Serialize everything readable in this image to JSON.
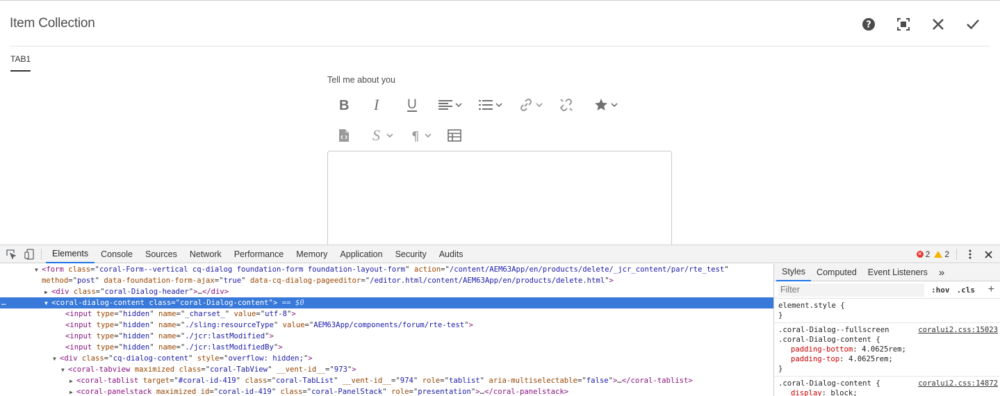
{
  "dialog": {
    "title": "Item Collection",
    "tab_label": "TAB1",
    "field_label": "Tell me about you",
    "actions": [
      "help-icon",
      "fullscreen-icon",
      "close-icon",
      "done-icon"
    ]
  },
  "devtools": {
    "tabs": [
      "Elements",
      "Console",
      "Sources",
      "Network",
      "Performance",
      "Memory",
      "Application",
      "Security",
      "Audits"
    ],
    "active_tab": "Elements",
    "error_count": "2",
    "warning_count": "2",
    "dom_lines": [
      {
        "indent": 50,
        "arrow": "▼",
        "html": "<span class=\"t\">&lt;form</span> <span class=\"a\">class</span><span class=\"x\">=\"</span><span class=\"v\">coral-Form--vertical cq-dialog foundation-form foundation-layout-form</span><span class=\"x\">\"</span> <span class=\"a\">action</span><span class=\"x\">=\"</span><span class=\"v\">/content/AEM63App/en/products/delete/_jcr_content/par/rte_test</span><span class=\"x\">\"</span>"
      },
      {
        "indent": 50,
        "arrow": "",
        "html": "<span class=\"a\">method</span><span class=\"x\">=\"</span><span class=\"v\">post</span><span class=\"x\">\"</span> <span class=\"a\">data-foundation-form-ajax</span><span class=\"x\">=\"</span><span class=\"v\">true</span><span class=\"x\">\"</span> <span class=\"a\">data-cq-dialog-pageeditor</span><span class=\"x\">=\"</span><span class=\"v\">/editor.html/content/AEM63App/en/products/delete.html</span><span class=\"x\">\"</span><span class=\"t\">&gt;</span>"
      },
      {
        "indent": 64,
        "arrow": "▶",
        "html": "<span class=\"t\">&lt;div</span> <span class=\"a\">class</span><span class=\"x\">=\"</span><span class=\"v\">coral-Dialog-header</span><span class=\"x\">\"</span><span class=\"t\">&gt;</span><span class=\"x\">…</span><span class=\"t\">&lt;/div&gt;</span>"
      },
      {
        "indent": 64,
        "arrow": "▼",
        "sel": true,
        "html": "<span class=\"t\">&lt;coral-dialog-content</span> <span class=\"a\">class</span><span class=\"x\">=\"</span><span class=\"v\">coral-Dialog-content</span><span class=\"x\">\"</span><span class=\"t\">&gt;</span> <span class=\"selmark\">== $0</span>"
      },
      {
        "indent": 84,
        "arrow": "",
        "html": "<span class=\"t\">&lt;input</span> <span class=\"a\">type</span><span class=\"x\">=\"</span><span class=\"v\">hidden</span><span class=\"x\">\"</span> <span class=\"a\">name</span><span class=\"x\">=\"</span><span class=\"v\">_charset_</span><span class=\"x\">\"</span> <span class=\"a\">value</span><span class=\"x\">=\"</span><span class=\"v\">utf-8</span><span class=\"x\">\"</span><span class=\"t\">&gt;</span>"
      },
      {
        "indent": 84,
        "arrow": "",
        "html": "<span class=\"t\">&lt;input</span> <span class=\"a\">type</span><span class=\"x\">=\"</span><span class=\"v\">hidden</span><span class=\"x\">\"</span> <span class=\"a\">name</span><span class=\"x\">=\"</span><span class=\"v\">./sling:resourceType</span><span class=\"x\">\"</span> <span class=\"a\">value</span><span class=\"x\">=\"</span><span class=\"v\">AEM63App/components/forum/rte-test</span><span class=\"x\">\"</span><span class=\"t\">&gt;</span>"
      },
      {
        "indent": 84,
        "arrow": "",
        "html": "<span class=\"t\">&lt;input</span> <span class=\"a\">type</span><span class=\"x\">=\"</span><span class=\"v\">hidden</span><span class=\"x\">\"</span> <span class=\"a\">name</span><span class=\"x\">=\"</span><span class=\"v\">./jcr:lastModified</span><span class=\"x\">\"</span><span class=\"t\">&gt;</span>"
      },
      {
        "indent": 84,
        "arrow": "",
        "html": "<span class=\"t\">&lt;input</span> <span class=\"a\">type</span><span class=\"x\">=\"</span><span class=\"v\">hidden</span><span class=\"x\">\"</span> <span class=\"a\">name</span><span class=\"x\">=\"</span><span class=\"v\">./jcr:lastModifiedBy</span><span class=\"x\">\"</span><span class=\"t\">&gt;</span>"
      },
      {
        "indent": 76,
        "arrow": "▼",
        "html": "<span class=\"t\">&lt;div</span> <span class=\"a\">class</span><span class=\"x\">=\"</span><span class=\"v\">cq-dialog-content</span><span class=\"x\">\"</span> <span class=\"a\">style</span><span class=\"x\">=\"</span><span class=\"v\">overflow: hidden;</span><span class=\"x\">\"</span><span class=\"t\">&gt;</span>"
      },
      {
        "indent": 88,
        "arrow": "▼",
        "html": "<span class=\"t\">&lt;coral-tabview</span> <span class=\"a\">maximized</span> <span class=\"a\">class</span><span class=\"x\">=\"</span><span class=\"v\">coral-TabView</span><span class=\"x\">\"</span> <span class=\"a\">__vent-id__</span><span class=\"x\">=\"</span><span class=\"v\">973</span><span class=\"x\">\"</span><span class=\"t\">&gt;</span>"
      },
      {
        "indent": 100,
        "arrow": "▶",
        "html": "<span class=\"t\">&lt;coral-tablist</span> <span class=\"a\">target</span><span class=\"x\">=\"</span><span class=\"v\">#coral-id-419</span><span class=\"x\">\"</span> <span class=\"a\">class</span><span class=\"x\">=\"</span><span class=\"v\">coral-TabList</span><span class=\"x\">\"</span> <span class=\"a\">__vent-id__</span><span class=\"x\">=\"</span><span class=\"v\">974</span><span class=\"x\">\"</span> <span class=\"a\">role</span><span class=\"x\">=\"</span><span class=\"v\">tablist</span><span class=\"x\">\"</span> <span class=\"a\">aria-multiselectable</span><span class=\"x\">=\"</span><span class=\"v\">false</span><span class=\"x\">\"</span><span class=\"t\">&gt;</span><span class=\"x\">…</span><span class=\"t\">&lt;/coral-tablist&gt;</span>"
      },
      {
        "indent": 100,
        "arrow": "▶",
        "html": "<span class=\"t\">&lt;coral-panelstack</span> <span class=\"a\">maximized</span> <span class=\"a\">id</span><span class=\"x\">=\"</span><span class=\"v\">coral-id-419</span><span class=\"x\">\"</span> <span class=\"a\">class</span><span class=\"x\">=\"</span><span class=\"v\">coral-PanelStack</span><span class=\"x\">\"</span> <span class=\"a\">role</span><span class=\"x\">=\"</span><span class=\"v\">presentation</span><span class=\"x\">\"</span><span class=\"t\">&gt;</span><span class=\"x\">…</span><span class=\"t\">&lt;/coral-panelstack&gt;</span>"
      }
    ],
    "styles_panel": {
      "tabs": [
        "Styles",
        "Computed",
        "Event Listeners"
      ],
      "more": "»",
      "filter_placeholder": "Filter",
      "hov": ":hov",
      "cls": ".cls",
      "plus": "+",
      "rules": [
        {
          "selector": "element.style {",
          "source": "",
          "props": [],
          "close": "}"
        },
        {
          "selector": ".coral-Dialog--fullscreen\n.coral-Dialog-content {",
          "source": "coralui2.css:15023",
          "props": [
            [
              "padding-bottom",
              "4.0625rem;"
            ],
            [
              "padding-top",
              "4.0625rem;"
            ]
          ],
          "close": "}"
        },
        {
          "selector": ".coral-Dialog-content {",
          "source": "coralui2.css:14872",
          "props": [
            [
              "display",
              "block;"
            ]
          ],
          "close": ""
        }
      ]
    }
  }
}
